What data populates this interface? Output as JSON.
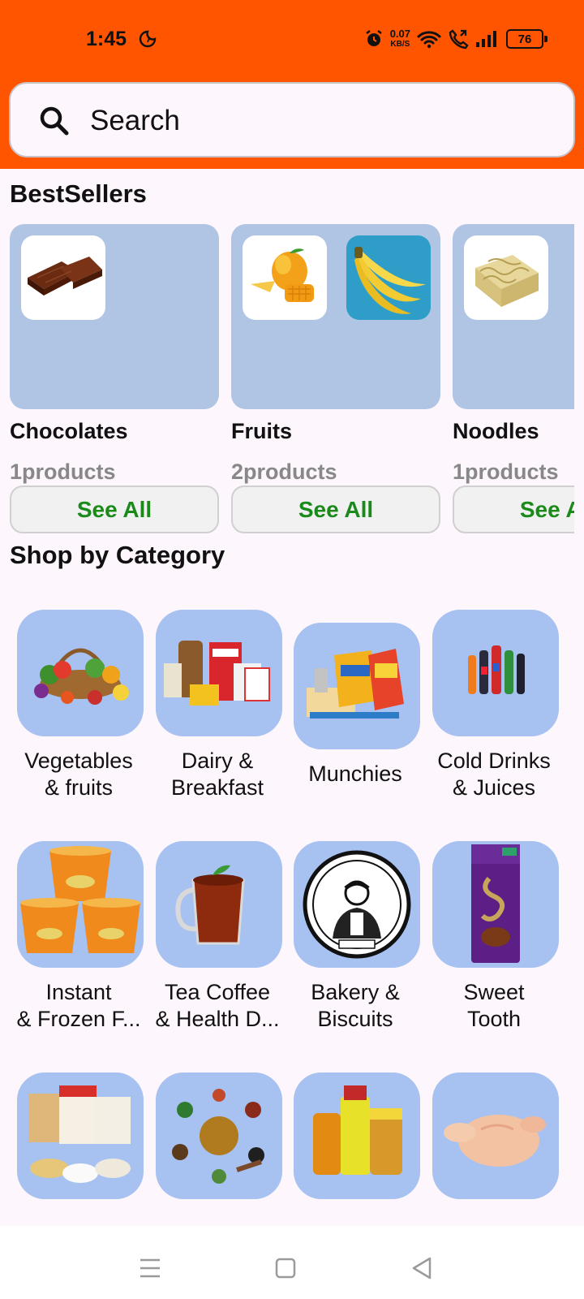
{
  "status": {
    "time": "1:45",
    "speed_value": "0.07",
    "speed_unit": "KB/S",
    "battery": "76"
  },
  "search": {
    "placeholder": "Search"
  },
  "bestsellers": {
    "title": "BestSellers",
    "items": [
      {
        "name": "Chocolates",
        "count": "1products",
        "button": "See All"
      },
      {
        "name": "Fruits",
        "count": "2products",
        "button": "See All"
      },
      {
        "name": "Noodles",
        "count": "1products",
        "button": "See All"
      }
    ]
  },
  "categories": {
    "title": "Shop by Category",
    "items": [
      {
        "line1": "Vegetables",
        "line2": "& fruits"
      },
      {
        "line1": "Dairy &",
        "line2": "Breakfast"
      },
      {
        "line1": "Munchies",
        "line2": ""
      },
      {
        "line1": "Cold Drinks",
        "line2": "& Juices"
      },
      {
        "line1": "Instant",
        "line2": "& Frozen F..."
      },
      {
        "line1": "Tea Coffee",
        "line2": "& Health D..."
      },
      {
        "line1": "Bakery &",
        "line2": "Biscuits"
      },
      {
        "line1": "Sweet",
        "line2": "Tooth"
      }
    ]
  },
  "colors": {
    "header": "#ff5400",
    "card": "#b0c4e4",
    "tile": "#a7c1f1",
    "see_all": "#1b8a1b"
  }
}
